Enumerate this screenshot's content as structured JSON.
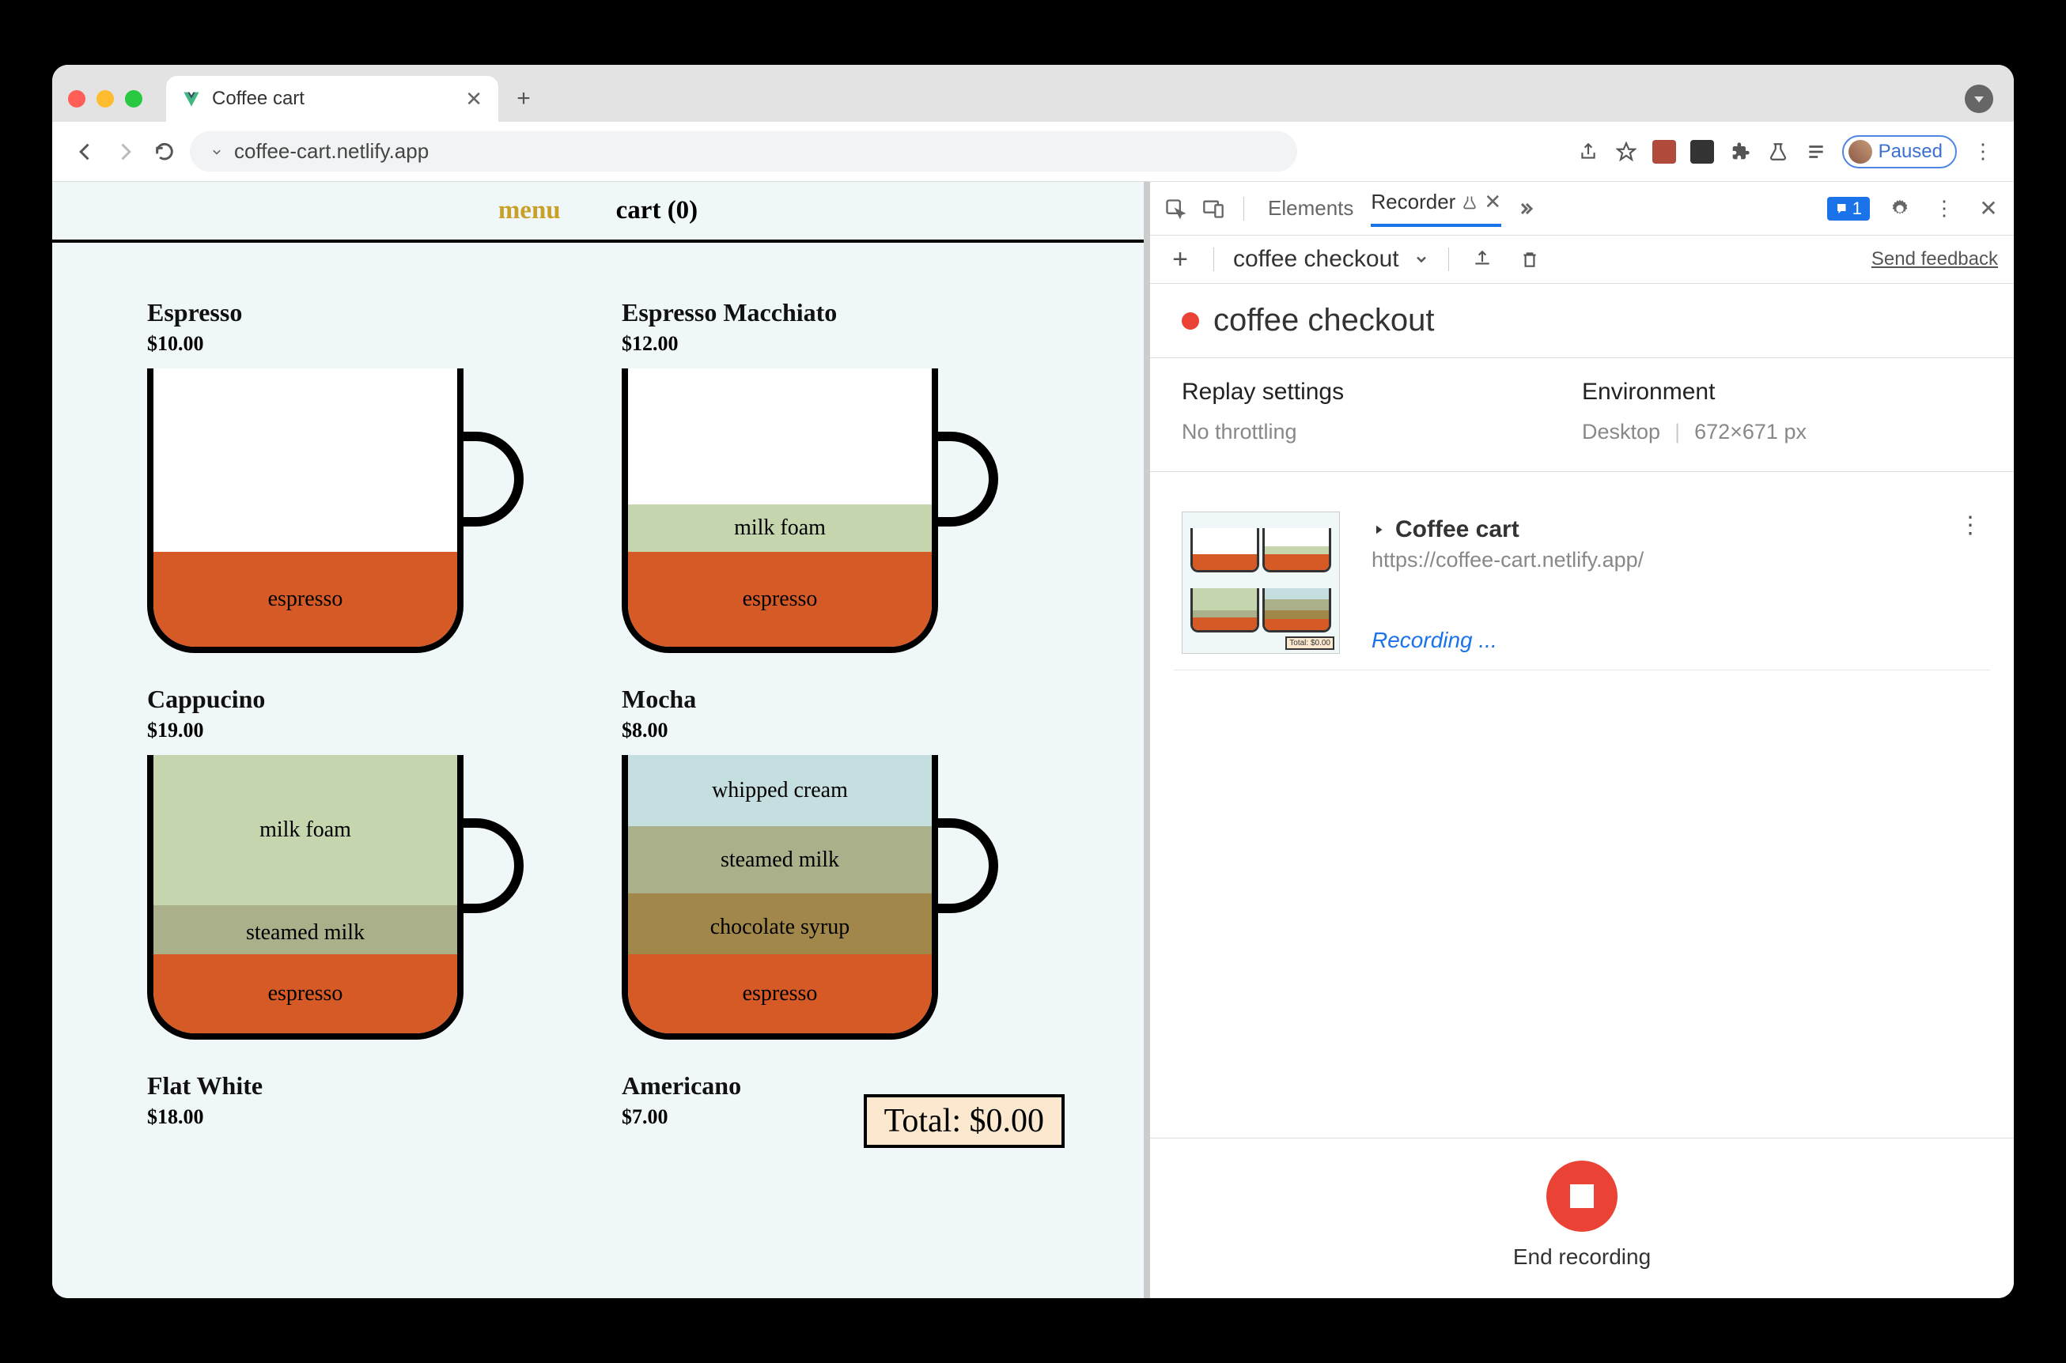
{
  "browser": {
    "tab_title": "Coffee cart",
    "url": "coffee-cart.netlify.app",
    "paused_label": "Paused"
  },
  "extensions": {
    "issue_count": "1"
  },
  "app": {
    "nav": {
      "menu": "menu",
      "cart": "cart (0)"
    },
    "total_label": "Total: $0.00",
    "products": [
      {
        "name": "Espresso",
        "price": "$10.00"
      },
      {
        "name": "Espresso Macchiato",
        "price": "$12.00"
      },
      {
        "name": "Cappucino",
        "price": "$19.00"
      },
      {
        "name": "Mocha",
        "price": "$8.00"
      },
      {
        "name": "Flat White",
        "price": "$18.00"
      },
      {
        "name": "Americano",
        "price": "$7.00"
      }
    ],
    "layers": {
      "espresso": "espresso",
      "milk_foam": "milk foam",
      "steamed_milk": "steamed milk",
      "whipped_cream": "whipped cream",
      "chocolate_syrup": "chocolate syrup"
    }
  },
  "devtools": {
    "tabs": {
      "elements": "Elements",
      "recorder": "Recorder"
    },
    "recording_select": "coffee checkout",
    "feedback": "Send feedback",
    "recording_title": "coffee checkout",
    "replay": {
      "label": "Replay settings",
      "value": "No throttling"
    },
    "env": {
      "label": "Environment",
      "device": "Desktop",
      "size": "672×671 px"
    },
    "step": {
      "title": "Coffee cart",
      "url": "https://coffee-cart.netlify.app/",
      "status": "Recording ..."
    },
    "end_label": "End recording"
  }
}
